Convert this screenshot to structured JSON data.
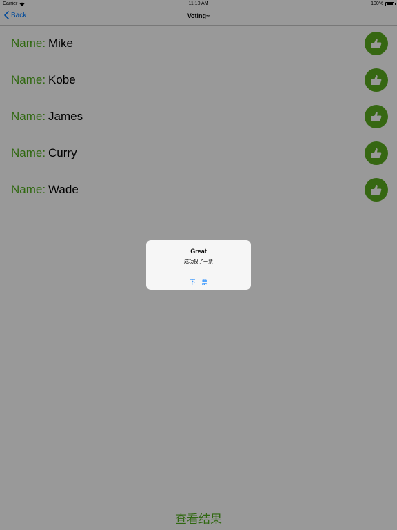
{
  "status_bar": {
    "carrier": "Carrier",
    "time": "11:10 AM",
    "battery": "100%"
  },
  "nav": {
    "back_label": "Back",
    "title": "Voting~"
  },
  "list": {
    "label": "Name:",
    "rows": [
      {
        "name": "Mike"
      },
      {
        "name": "Kobe"
      },
      {
        "name": "James"
      },
      {
        "name": "Curry"
      },
      {
        "name": "Wade"
      }
    ]
  },
  "bottom": {
    "results_label": "查看结果"
  },
  "alert": {
    "title": "Great",
    "message": "成功投了一票",
    "action_label": "下一票"
  },
  "colors": {
    "accent_green": "#50ad1c",
    "button_green": "#5aac1f",
    "ios_blue": "#007aff"
  },
  "icons": {
    "vote": "thumbs-up-icon",
    "back": "chevron-left-icon",
    "wifi": "wifi-icon",
    "battery": "battery-icon"
  }
}
